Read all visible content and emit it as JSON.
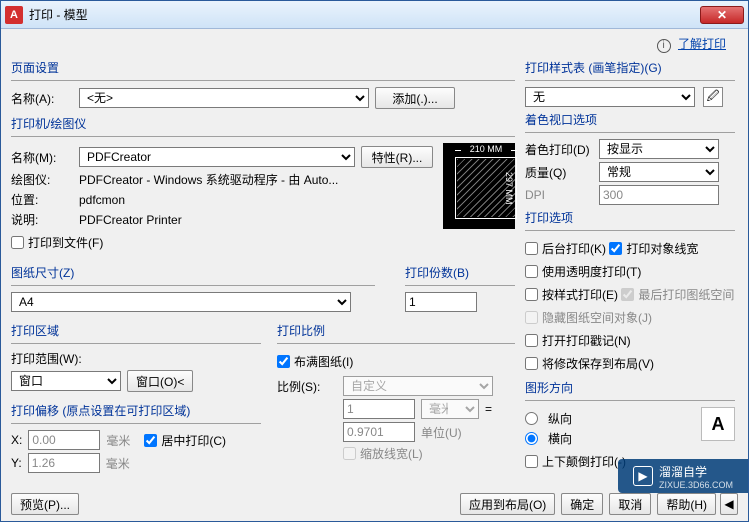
{
  "window": {
    "title": "打印 - 模型"
  },
  "toplink": {
    "label": "了解打印"
  },
  "page_setup": {
    "title": "页面设置",
    "name_label": "名称(A):",
    "name_value": "<无>",
    "add_btn": "添加(.)..."
  },
  "printer": {
    "title": "打印机/绘图仪",
    "name_label": "名称(M):",
    "name_value": "PDFCreator",
    "props_btn": "特性(R)...",
    "plotter_label": "绘图仪:",
    "plotter_value": "PDFCreator - Windows 系统驱动程序 - 由 Auto...",
    "where_label": "位置:",
    "where_value": "pdfcmon",
    "desc_label": "说明:",
    "desc_value": "PDFCreator Printer",
    "tofile_label": "打印到文件(F)",
    "preview_w": "210 MM",
    "preview_h": "297 MM"
  },
  "paper": {
    "title": "图纸尺寸(Z)",
    "value": "A4",
    "copies_title": "打印份数(B)",
    "copies_value": "1"
  },
  "area": {
    "title": "打印区域",
    "range_label": "打印范围(W):",
    "range_value": "窗口",
    "window_btn": "窗口(O)<"
  },
  "offset": {
    "title": "打印偏移 (原点设置在可打印区域)",
    "x_label": "X:",
    "x_value": "0.00",
    "x_unit": "毫米",
    "y_label": "Y:",
    "y_value": "1.26",
    "y_unit": "毫米",
    "center_label": "居中打印(C)"
  },
  "scale_grp": {
    "title": "打印比例",
    "fit_label": "布满图纸(I)",
    "scale_label": "比例(S):",
    "scale_value": "自定义",
    "num_value": "1",
    "num_unit": "毫米",
    "den_value": "0.9701",
    "den_unit": "单位(U)",
    "scale_lw_label": "缩放线宽(L)"
  },
  "styletable": {
    "title": "打印样式表 (画笔指定)(G)",
    "value": "无"
  },
  "shaded": {
    "title": "着色视口选项",
    "shade_label": "着色打印(D)",
    "shade_value": "按显示",
    "quality_label": "质量(Q)",
    "quality_value": "常规",
    "dpi_label": "DPI",
    "dpi_value": "300"
  },
  "options": {
    "title": "打印选项",
    "o1": "后台打印(K)",
    "o2": "打印对象线宽",
    "o3": "使用透明度打印(T)",
    "o4": "按样式打印(E)",
    "o5": "最后打印图纸空间",
    "o6": "隐藏图纸空间对象(J)",
    "o7": "打开打印戳记(N)",
    "o8": "将修改保存到布局(V)"
  },
  "orient": {
    "title": "图形方向",
    "r1": "纵向",
    "r2": "横向",
    "r3": "上下颠倒打印(-)"
  },
  "footer": {
    "preview": "预览(P)...",
    "apply": "应用到布局(O)",
    "ok": "确定",
    "cancel": "取消",
    "help": "帮助(H)"
  },
  "watermark": {
    "brand": "溜溜自学",
    "url": "ZIXUE.3D66.COM"
  }
}
